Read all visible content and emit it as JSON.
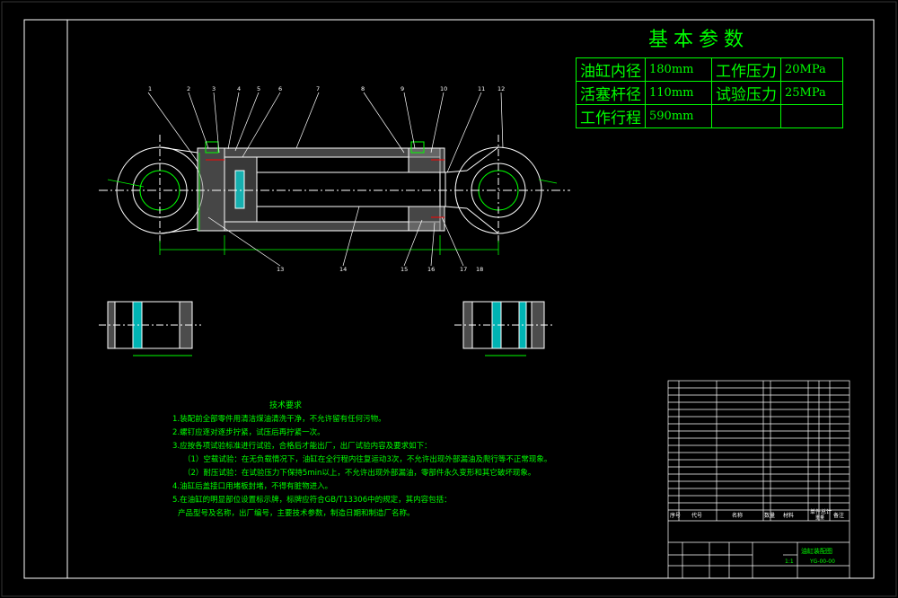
{
  "title": "基本参数",
  "params": [
    {
      "label": "油缸内径",
      "value": "180mm",
      "label2": "工作压力",
      "value2": "20MPa"
    },
    {
      "label": "活塞杆径",
      "value": "110mm",
      "label2": "试验压力",
      "value2": "25MPa"
    },
    {
      "label": "工作行程",
      "value": "590mm",
      "label2": "",
      "value2": ""
    }
  ],
  "tech": {
    "heading": "技术要求",
    "lines": [
      "1.装配前全部零件用清洁煤油清洗干净，不允许留有任何污物。",
      "2.螺钉应逐对逐步拧紧，试压后再拧紧一次。",
      "3.应按各项试验标准进行试验，合格后才能出厂，出厂试验内容及要求如下：",
      "（1）空载试验：在无负载情况下，油缸在全行程内往复运动3次，不允许出现外部漏油及爬行等不正常现象。",
      "（2）耐压试验：在试验压力下保持5min以上，不允许出现外部漏油，零部件永久变形和其它破坏现象。",
      "4.油缸后盖接口用堵板封堵，不得有脏物进入。",
      "5.在油缸的明显部位设置标示牌，标牌应符合GB/T13306中的规定，其内容包括：",
      "产品型号及名称，出厂编号，主要技术参数，制造日期和制造厂名称。"
    ]
  },
  "callouts": [
    "1",
    "2",
    "3",
    "4",
    "5",
    "6",
    "7",
    "8",
    "9",
    "10",
    "11",
    "12",
    "13",
    "14",
    "15",
    "16",
    "17",
    "18"
  ],
  "titleblock": {
    "header": [
      "序号",
      "代号",
      "名称",
      "数量",
      "材料",
      "单件",
      "总计",
      "备注"
    ],
    "weight_label": "重量",
    "drawing_title": "油缸装配图",
    "drawing_no": "YG-00-00",
    "scale": "1:1"
  },
  "colors": {
    "line": "#ffffff",
    "green": "#00ff00",
    "cyan": "#00ffff",
    "hatch": "#7f7f7f",
    "red": "#ff0000",
    "frame": "#ffffff"
  }
}
